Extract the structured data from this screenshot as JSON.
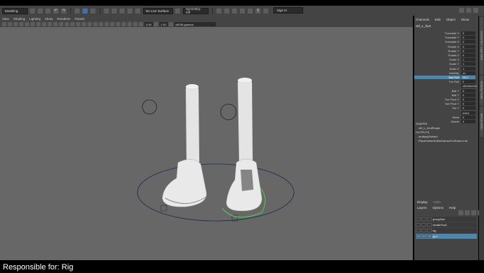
{
  "topbar": {
    "mode": "Modeling",
    "surface": "No Live Surface",
    "symmetry": "Symmetry: Off",
    "signin": "Sign In"
  },
  "viewport_menu": [
    "View",
    "Shading",
    "Lighting",
    "Show",
    "Renderer",
    "Panels"
  ],
  "viewport_toolbar": {
    "value1": "0.00",
    "value2": "1.00",
    "colorspace": "sRGB gamma"
  },
  "channel_box": {
    "tabs": [
      "Channels",
      "Edit",
      "Object",
      "Show"
    ],
    "object_name": "ctrl_L_foot",
    "attributes": [
      {
        "label": "Translate X",
        "value": "0"
      },
      {
        "label": "Translate Y",
        "value": "0"
      },
      {
        "label": "Translate Z",
        "value": "0"
      },
      {
        "label": "Rotate X",
        "value": "0"
      },
      {
        "label": "Rotate Y",
        "value": "0"
      },
      {
        "label": "Rotate Z",
        "value": "0"
      },
      {
        "label": "Scale X",
        "value": "1"
      },
      {
        "label": "Scale Y",
        "value": "1"
      },
      {
        "label": "Scale Z",
        "value": "1"
      },
      {
        "label": "Visibility",
        "value": "on"
      },
      {
        "label": "Ball Roll",
        "value": "26.2",
        "selected": true
      },
      {
        "label": "Toe Roll",
        "value": "0"
      },
      {
        "label": "",
        "value": "offswitches"
      },
      {
        "label": "Ball Y",
        "value": "0"
      },
      {
        "label": "Ball Y",
        "value": "0"
      },
      {
        "label": "Toe Pivot X",
        "value": "0"
      },
      {
        "label": "Toe Pivot Y",
        "value": "0"
      },
      {
        "label": "Toe Y",
        "value": "0"
      },
      {
        "label": "",
        "value": "extra"
      },
      {
        "label": "Bank",
        "value": "0"
      },
      {
        "label": "Swivel",
        "value": "0"
      }
    ],
    "shapes_header": "SHAPES",
    "shape": "ctrl_L_footShape",
    "outputs_header": "OUTPUTS",
    "outputs": [
      "multiplyDivide4",
      "PlaceHolderEditorNamesForRules Info"
    ]
  },
  "layers": {
    "tabs": [
      "Display",
      "Anim"
    ],
    "menu": [
      "Layers",
      "Options",
      "Help"
    ],
    "rows": [
      {
        "name": "proxyGeo",
        "selected": false
      },
      {
        "name": "renderFoot",
        "selected": false
      },
      {
        "name": "rig",
        "selected": false
      },
      {
        "name": "geo",
        "selected": true
      }
    ]
  },
  "side_tabs": [
    "Channel Box / Layer Editor",
    "Modeling Toolkit",
    "Attribute Editor"
  ],
  "caption": "Responsible for: Rig"
}
